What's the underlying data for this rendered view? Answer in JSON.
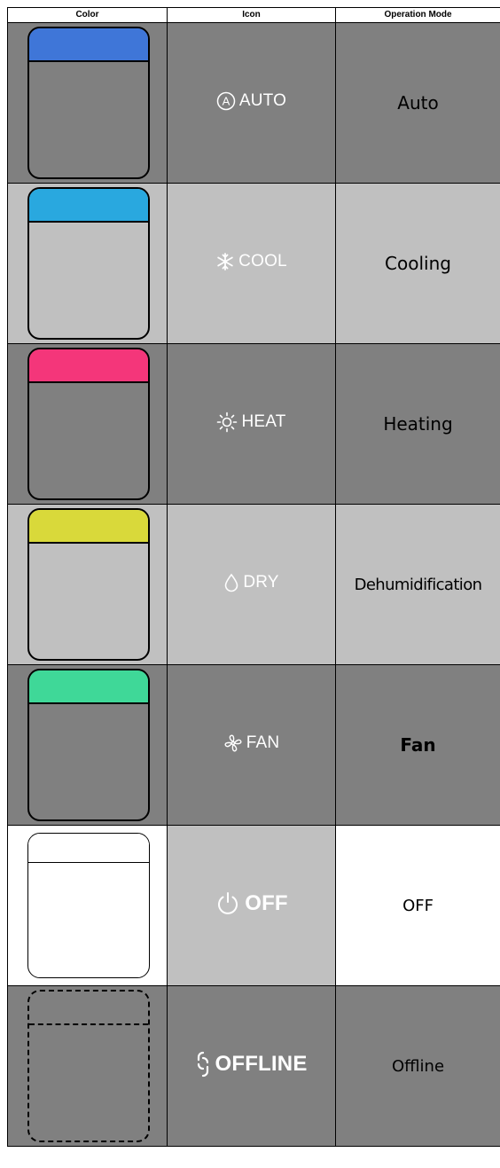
{
  "table": {
    "headers": {
      "color": "Color",
      "icon": "Icon",
      "operation_mode": "Operation Mode"
    },
    "rows": [
      {
        "swatch_color": "#3f76d8",
        "icon_name": "auto-icon",
        "icon_label": "AUTO",
        "icon_color": "#ffffff",
        "mode": "Auto"
      },
      {
        "swatch_color": "#29a8df",
        "icon_name": "snowflake-icon",
        "icon_label": "COOL",
        "icon_color": "#ffffff",
        "mode": "Cooling"
      },
      {
        "swatch_color": "#f4367a",
        "icon_name": "sun-icon",
        "icon_label": "HEAT",
        "icon_color": "#ffffff",
        "mode": "Heating"
      },
      {
        "swatch_color": "#d9d93a",
        "icon_name": "droplet-icon",
        "icon_label": "DRY",
        "icon_color": "#ffffff",
        "mode": "Dehumidification"
      },
      {
        "swatch_color": "#3fd898",
        "icon_name": "fan-icon",
        "icon_label": "FAN",
        "icon_color": "#ffffff",
        "mode": "Fan"
      },
      {
        "swatch_color": "#c0c0c0",
        "icon_name": "power-icon",
        "icon_label": "OFF",
        "icon_color": "#ffffff",
        "mode": "OFF"
      },
      {
        "swatch_color": "#808080",
        "icon_name": "link-icon",
        "icon_label": "OFFLINE",
        "icon_color": "#ffffff",
        "mode": "Offline"
      }
    ]
  }
}
